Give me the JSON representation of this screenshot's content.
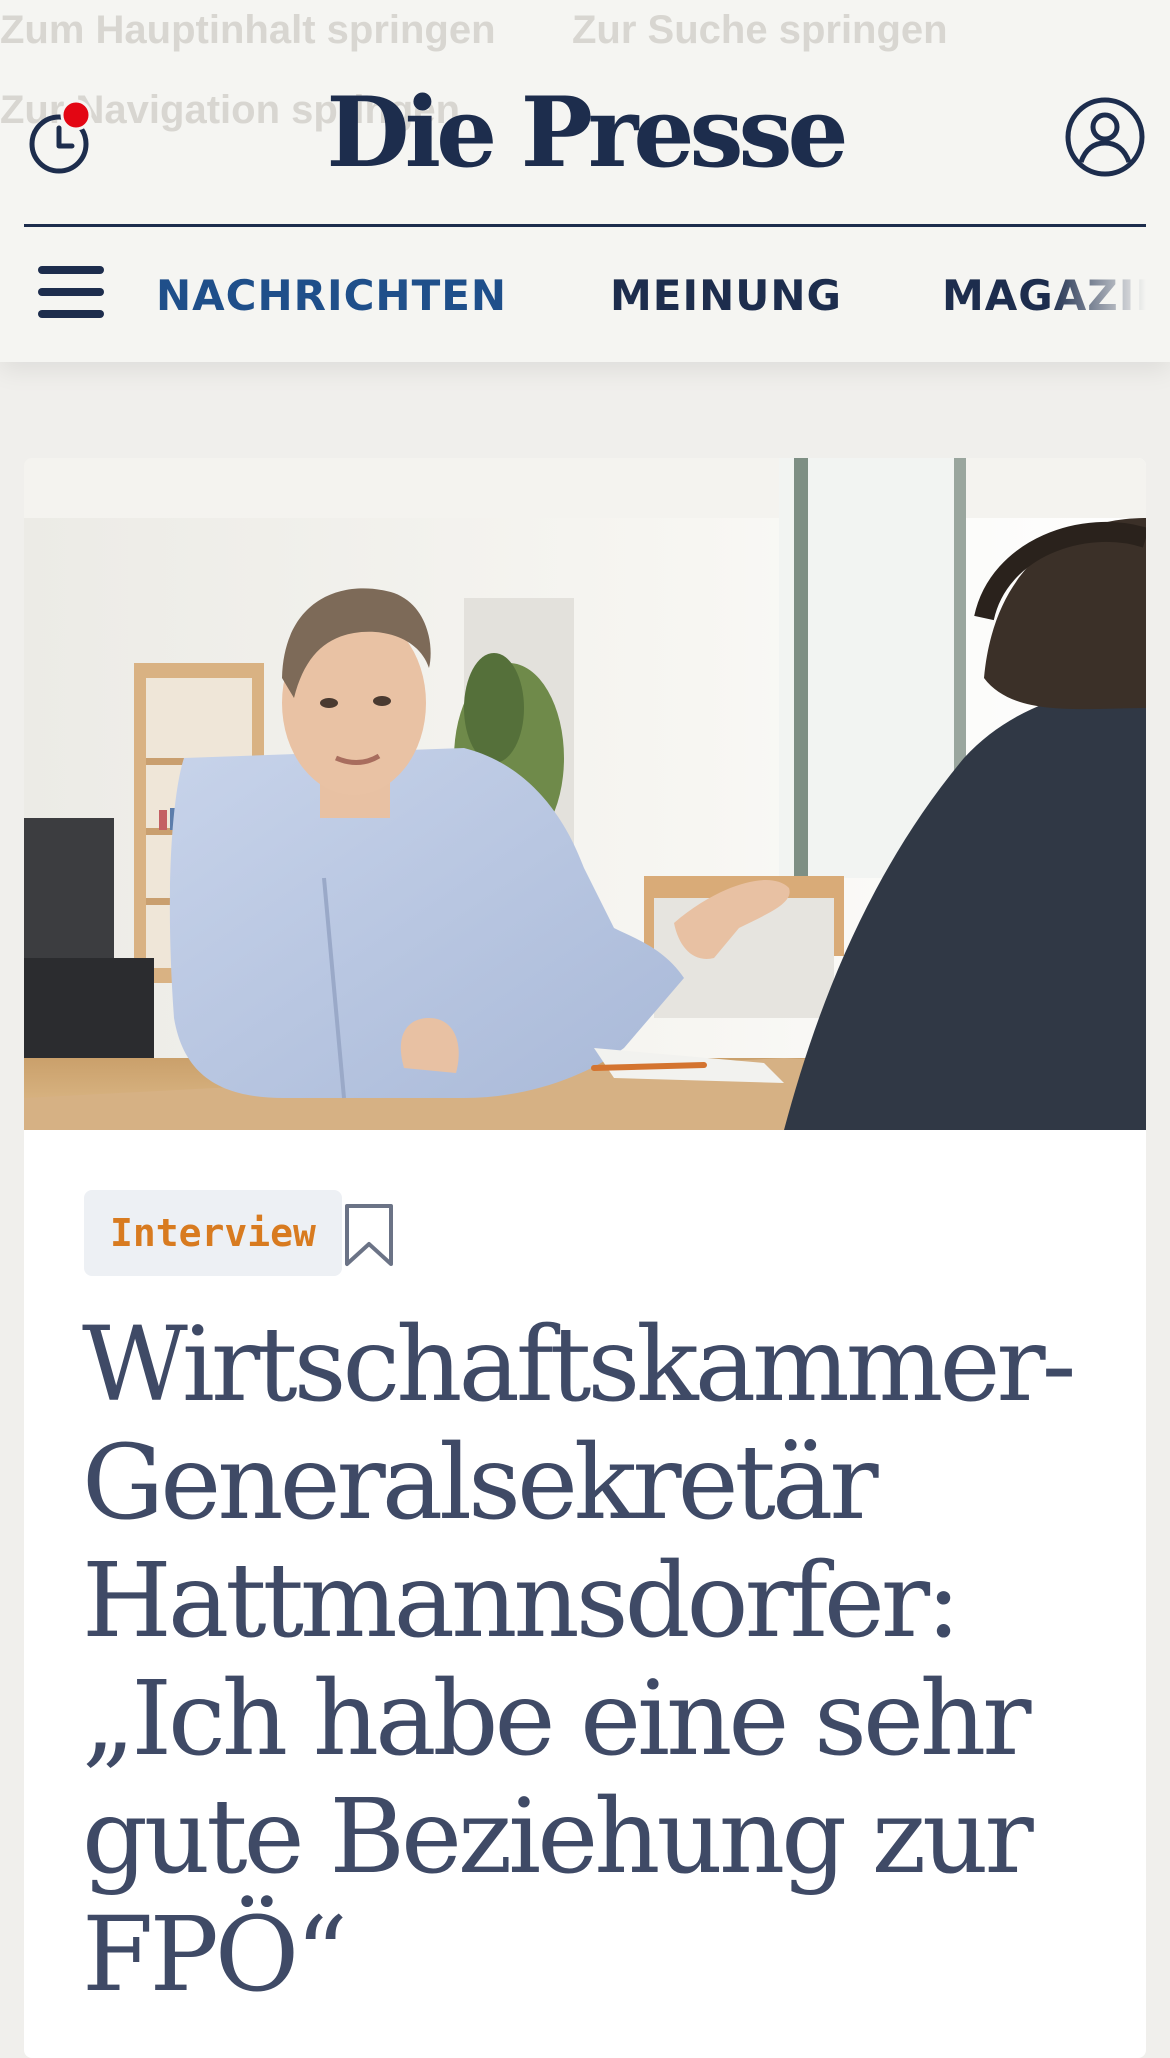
{
  "skip_links": [
    "Zum Hauptinhalt springen",
    "Zur Suche springen",
    "Zur Navigation springen"
  ],
  "header": {
    "logo": "Die Presse",
    "notification_color": "#e30613",
    "brand_color": "#1d2d4d"
  },
  "nav": {
    "items": [
      {
        "label": "NACHRICHTEN",
        "active": true
      },
      {
        "label": "MEINUNG",
        "active": false
      },
      {
        "label": "MAGAZIN",
        "active": false
      }
    ],
    "active_color": "#1f4f8a",
    "color": "#1d2d4d"
  },
  "article": {
    "category": "Interview",
    "headline": "Wirtschaftskammer-Generalsekretär Hattmannsdorfer: „Ich habe eine sehr gute Beziehung zur FPÖ“"
  }
}
